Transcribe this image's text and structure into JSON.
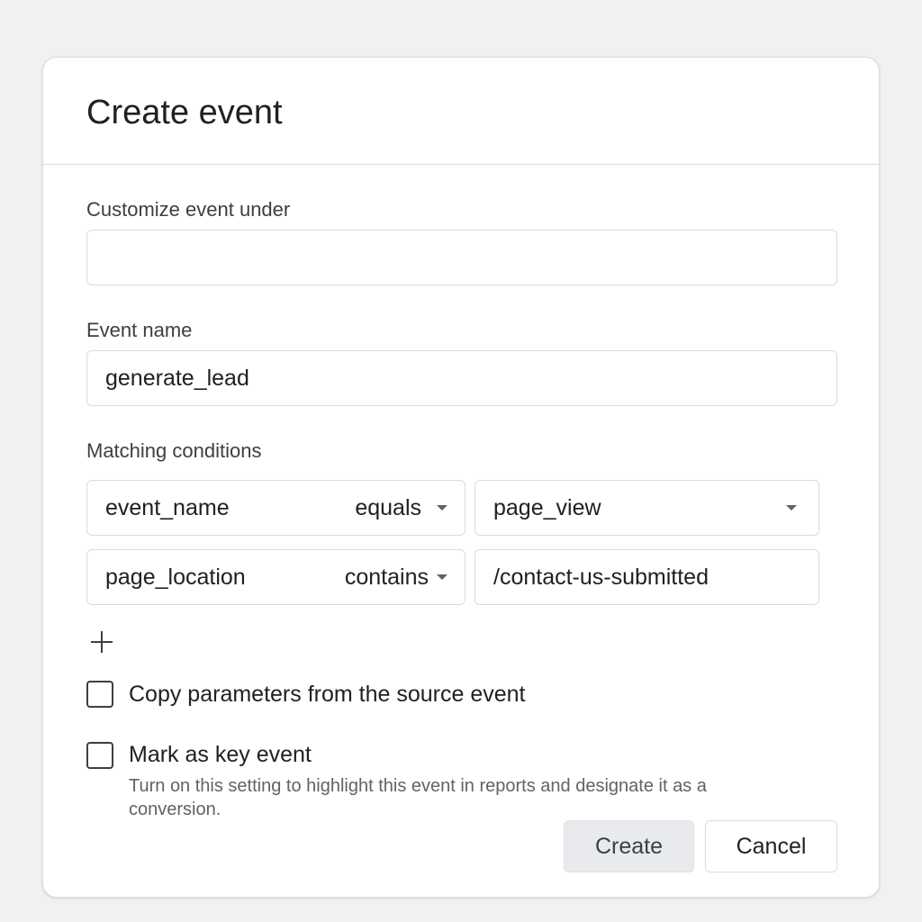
{
  "dialog": {
    "title": "Create event",
    "customize_label": "Customize event under",
    "customize_value": "",
    "event_name_label": "Event name",
    "event_name_value": "generate_lead",
    "matching_label": "Matching conditions",
    "conditions": [
      {
        "parameter": "event_name",
        "operator": "equals",
        "value": "page_view",
        "value_has_dropdown": true
      },
      {
        "parameter": "page_location",
        "operator": "contains",
        "value": "/contact-us-submitted",
        "value_has_dropdown": false
      }
    ],
    "add_condition_icon": "plus-icon",
    "copy_params_label": "Copy parameters from the source event",
    "copy_params_checked": false,
    "key_event_label": "Mark as key event",
    "key_event_checked": false,
    "key_event_help": "Turn on this setting to highlight this event in reports and designate it as a conversion.",
    "create_label": "Create",
    "cancel_label": "Cancel"
  }
}
